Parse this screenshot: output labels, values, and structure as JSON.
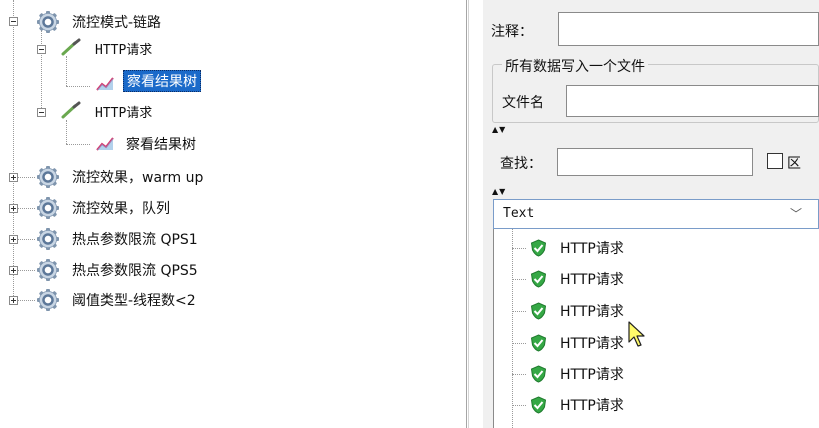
{
  "tree": {
    "items": [
      {
        "label": "流控模式-链路",
        "mono": false
      },
      {
        "label": "HTTP请求",
        "mono": true
      },
      {
        "label": "察看结果树",
        "mono": false,
        "selected": true
      },
      {
        "label": "HTTP请求",
        "mono": true
      },
      {
        "label": "察看结果树",
        "mono": false
      },
      {
        "label": "流控效果，warm up",
        "mono": false
      },
      {
        "label": "流控效果，队列",
        "mono": false
      },
      {
        "label": "热点参数限流 QPS1",
        "mono": false
      },
      {
        "label": "热点参数限流 QPS5",
        "mono": false
      },
      {
        "label": "阈值类型-线程数<2",
        "mono": false
      }
    ]
  },
  "panel": {
    "comment_label": "注释：",
    "group_title": "所有数据写入一个文件",
    "filename_label": "文件名",
    "search_label": "查找：",
    "checkbox_label": "区"
  },
  "renderer": {
    "selected": "Text",
    "arrow": "﹀"
  },
  "results": {
    "items": [
      "HTTP请求",
      "HTTP请求",
      "HTTP请求",
      "HTTP请求",
      "HTTP请求",
      "HTTP请求"
    ]
  },
  "colors": {
    "selection": "#1b6ac9",
    "success": "#35a845",
    "panel_bg": "#f0f0f0"
  },
  "icons": {
    "controller": "gear-icon",
    "sampler": "pipette-icon",
    "listener": "chart-icon",
    "success": "shield-check-icon"
  }
}
